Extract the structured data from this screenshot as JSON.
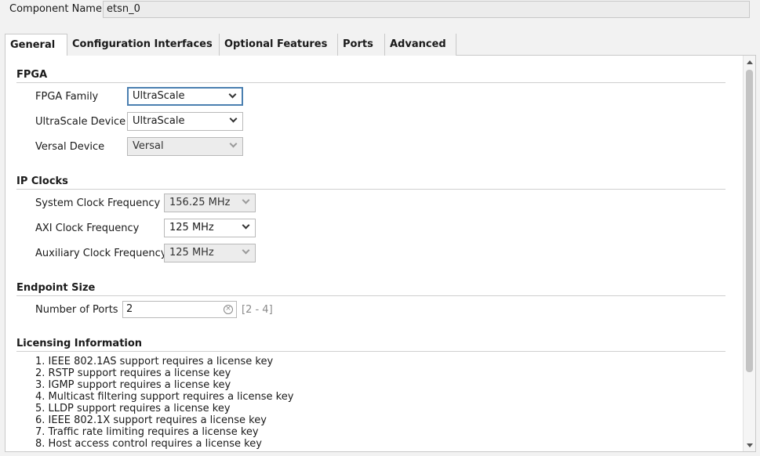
{
  "component": {
    "label": "Component Name",
    "value": "etsn_0"
  },
  "tabs": [
    {
      "label": "General",
      "active": true
    },
    {
      "label": "Configuration Interfaces",
      "active": false
    },
    {
      "label": "Optional Features",
      "active": false
    },
    {
      "label": "Ports",
      "active": false
    },
    {
      "label": "Advanced",
      "active": false
    }
  ],
  "fpga": {
    "title": "FPGA",
    "family": {
      "label": "FPGA Family",
      "value": "UltraScale"
    },
    "ultrascale_device": {
      "label": "UltraScale Device",
      "value": "UltraScale"
    },
    "versal_device": {
      "label": "Versal Device",
      "value": "Versal"
    }
  },
  "clocks": {
    "title": "IP Clocks",
    "system": {
      "label": "System Clock Frequency",
      "value": "156.25 MHz"
    },
    "axi": {
      "label": "AXI Clock Frequency",
      "value": "125 MHz"
    },
    "aux": {
      "label": "Auxiliary Clock Frequency",
      "value": "125 MHz"
    }
  },
  "endpoint": {
    "title": "Endpoint Size",
    "ports": {
      "label": "Number of Ports",
      "value": "2",
      "range": "[2 - 4]"
    }
  },
  "licensing": {
    "title": "Licensing Information",
    "items": [
      "1. IEEE 802.1AS support requires a license key",
      "2. RSTP support requires a license key",
      "3. IGMP support requires a license key",
      "4. Multicast filtering support requires a license key",
      "5. LLDP support requires a license key",
      "6. IEEE 802.1X support requires a license key",
      "7. Traffic rate limiting requires a license key",
      "8. Host access control requires a license key"
    ]
  },
  "icons": {
    "select": "chevron-down-icon",
    "clear": "clear-icon",
    "scroll_up": "scroll-up-icon",
    "scroll_down": "scroll-down-icon"
  }
}
